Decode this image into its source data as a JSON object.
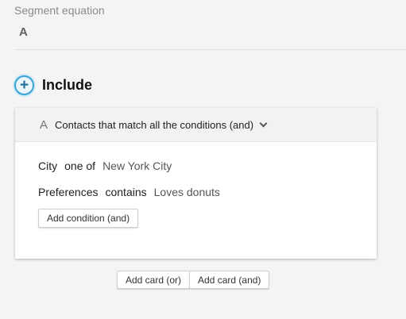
{
  "segment": {
    "label": "Segment equation",
    "equation": "A"
  },
  "include": {
    "icon": "plus-circle-icon",
    "title": "Include"
  },
  "card": {
    "letter": "A",
    "title": "Contacts that match all the conditions (and)",
    "conditions": [
      {
        "field": "City",
        "operator": "one of",
        "value": "New York City"
      },
      {
        "field": "Preferences",
        "operator": "contains",
        "value": "Loves donuts"
      }
    ],
    "add_condition_label": "Add condition (and)"
  },
  "footer": {
    "add_card_or": "Add card (or)",
    "add_card_and": "Add card (and)"
  },
  "colors": {
    "accent": "#3aa3d6",
    "background": "#f4f4f4"
  }
}
